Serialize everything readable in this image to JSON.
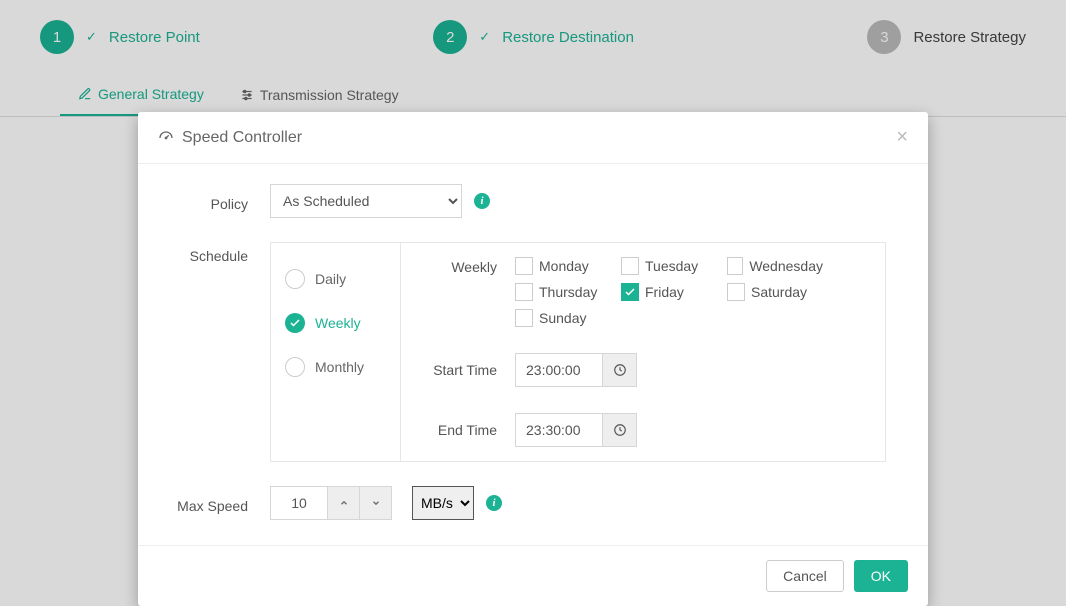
{
  "wizard": {
    "step1": {
      "num": "1",
      "label": "Restore Point"
    },
    "step2": {
      "num": "2",
      "label": "Restore Destination"
    },
    "step3": {
      "num": "3",
      "label": "Restore Strategy"
    }
  },
  "tabs": {
    "general": "General Strategy",
    "transmission": "Transmission Strategy"
  },
  "modal": {
    "title": "Speed Controller",
    "policy_label": "Policy",
    "policy_value": "As Scheduled",
    "schedule_label": "Schedule",
    "periods": {
      "daily": "Daily",
      "weekly": "Weekly",
      "monthly": "Monthly"
    },
    "weekly_label": "Weekly",
    "days": {
      "mon": "Monday",
      "tue": "Tuesday",
      "wed": "Wednesday",
      "thu": "Thursday",
      "fri": "Friday",
      "sat": "Saturday",
      "sun": "Sunday"
    },
    "start_label": "Start Time",
    "start_value": "23:00:00",
    "end_label": "End Time",
    "end_value": "23:30:00",
    "maxspeed_label": "Max Speed",
    "maxspeed_value": "10",
    "maxspeed_unit": "MB/s",
    "cancel": "Cancel",
    "ok": "OK"
  }
}
